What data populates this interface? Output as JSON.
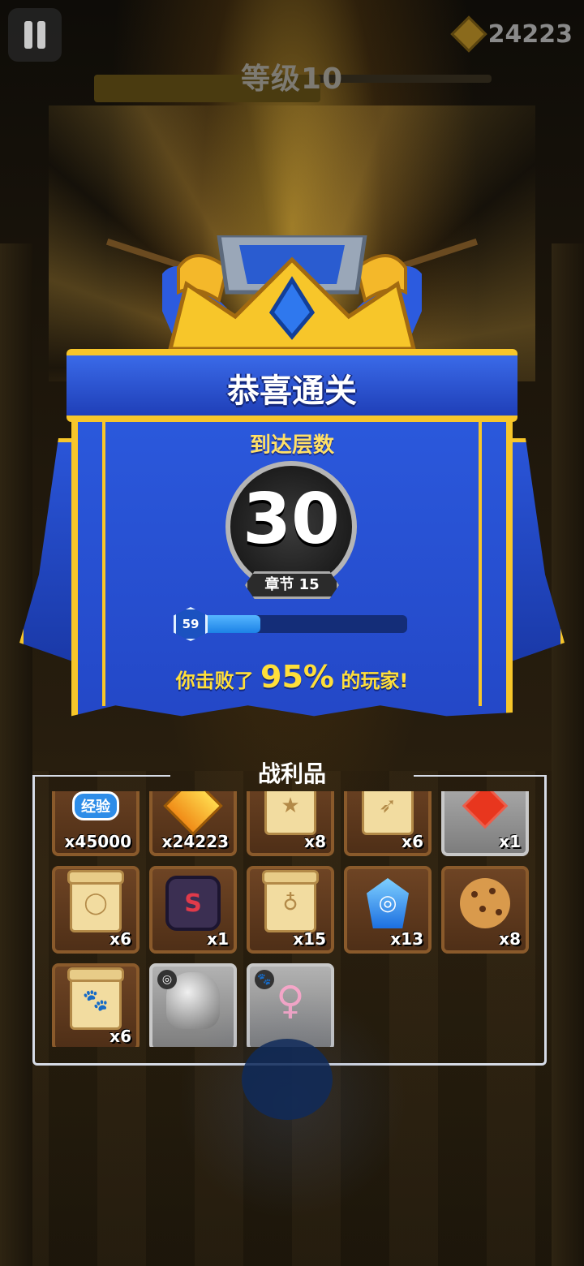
{
  "hud": {
    "coins": "24223",
    "level_label": "等级10",
    "level_progress": 0.57
  },
  "result": {
    "title": "恭喜通关",
    "floor_label": "到达层数",
    "floor_value": "30",
    "chapter": "章节 15",
    "player_level": "59",
    "xp_progress": 0.33,
    "beat_prefix": "你击败了",
    "beat_percent": "95%",
    "beat_suffix": "的玩家!"
  },
  "loot": {
    "title": "战利品",
    "items": [
      {
        "name": "xp-badge",
        "label": "经验",
        "count": "x45000",
        "style": "brown"
      },
      {
        "name": "archer-coin",
        "count": "x24223",
        "style": "brown"
      },
      {
        "name": "book-scroll",
        "count": "x8",
        "style": "brown"
      },
      {
        "name": "bow-scroll",
        "count": "x6",
        "style": "brown"
      },
      {
        "name": "red-gem",
        "count": "x1",
        "style": "grey"
      },
      {
        "name": "ring-scroll",
        "count": "x6",
        "style": "brown"
      },
      {
        "name": "dark-rune",
        "count": "x1",
        "style": "brown"
      },
      {
        "name": "amulet-scroll",
        "count": "x15",
        "style": "brown"
      },
      {
        "name": "blue-crystal",
        "count": "x13",
        "style": "brown"
      },
      {
        "name": "cookie",
        "count": "x8",
        "style": "brown"
      },
      {
        "name": "pet-scroll",
        "count": "x6",
        "style": "brown"
      },
      {
        "name": "bear-ring",
        "count": "",
        "style": "grey"
      },
      {
        "name": "fairy-pet",
        "count": "",
        "style": "grey"
      }
    ]
  }
}
